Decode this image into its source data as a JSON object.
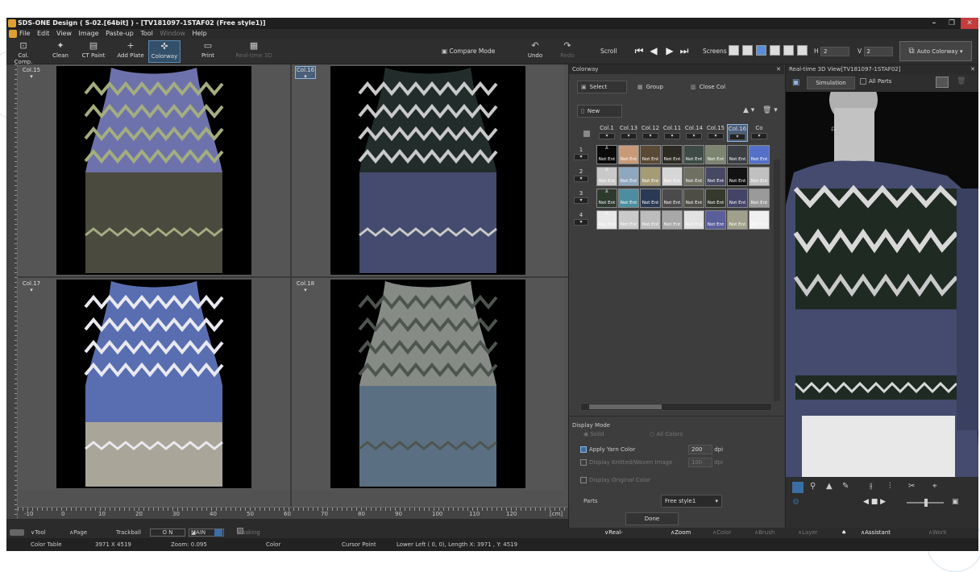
{
  "window": {
    "title": "SDS-ONE Design ( S-02.[64bit] ) - [TV181097-1STAF02 (Free style1)]",
    "controls": [
      "–",
      "❐",
      "✕"
    ]
  },
  "menu": [
    "File",
    "Edit",
    "View",
    "Image",
    "Paste-up",
    "Tool",
    "Window",
    "Help"
  ],
  "toolbar": {
    "col_comp": "Col. Comp.",
    "clean": "Clean",
    "ct_paint": "CT Paint",
    "add_plate": "Add Plate",
    "colorway": "Colorway",
    "print": "Print",
    "realtime_3d": "Real-time 3D",
    "compare_mode": "Compare Mode",
    "undo": "Undo",
    "redo": "Redo",
    "scroll": "Scroll",
    "screens": "Screens",
    "h_label": "H",
    "h_value": "2",
    "v_label": "V",
    "v_value": "2",
    "auto_colorway": "Auto Colorway"
  },
  "panes": [
    {
      "label": "Col.15",
      "selected": false,
      "body": "#4a4a3e",
      "accent": "#7277b8",
      "band": "#a4ad7e",
      "hem": "#6b6a58"
    },
    {
      "label": "Col.16",
      "selected": true,
      "body": "#444b6e",
      "accent": "#1f2a23",
      "band": "#c9c9c9",
      "hem": "#444b6e"
    },
    {
      "label": "Col.17",
      "selected": false,
      "body": "#a9a699",
      "accent": "#5068b4",
      "band": "#e9e9f0",
      "hem": "#a9a699"
    },
    {
      "label": "Col.18",
      "selected": false,
      "body": "#5b6f82",
      "accent": "#8b8e86",
      "band": "#4e5550",
      "hem": "#5b6f82"
    }
  ],
  "ruler": {
    "ticks": [
      "-10",
      "0",
      "10",
      "20",
      "30",
      "40",
      "50",
      "60",
      "70",
      "80",
      "90",
      "100",
      "110",
      "120"
    ],
    "unit": "[cm]"
  },
  "colorway_panel": {
    "title": "Colorway",
    "select": "Select",
    "group": "Group",
    "close_col": "Close Col",
    "new": "New",
    "columns": [
      "Col.1",
      "Col.13",
      "Col.12",
      "Col.11",
      "Col.14",
      "Col.15",
      "Col.16",
      "Co"
    ],
    "rows": [
      {
        "num": "1",
        "colors": [
          "#0a0a0a",
          "#c89a78",
          "#5a4a35",
          "#2c2a22",
          "#3d4a45",
          "#7c8570",
          "#3c3f44",
          "#5470c8"
        ]
      },
      {
        "num": "2",
        "colors": [
          "#c9c9c9",
          "#8fa8c0",
          "#a59c76",
          "#d6d6d6",
          "#6f6f62",
          "#464862",
          "#121212",
          "#c0c0c0"
        ]
      },
      {
        "num": "3",
        "colors": [
          "#2e3a2e",
          "#4c8ea0",
          "#2a3a55",
          "#4a4a4a",
          "#4e4e46",
          "#35382c",
          "#434466",
          "#9a9a9a"
        ]
      },
      {
        "num": "4",
        "colors": [
          "#e8e8e8",
          "#cacaca",
          "#bdbdbd",
          "#a8a8a8",
          "#e2e2e2",
          "#5a5e9a",
          "#a0a08c",
          "#f0f0f0"
        ]
      }
    ],
    "not_ent": "Not Ent",
    "display_mode": "Display Mode",
    "solid": "Solid",
    "all_colors": "All Colors",
    "apply_yarn_color": "Apply Yarn Color",
    "dpi_value_1": "200",
    "dpi": "dpi",
    "display_knitted": "Display Knitted/Woven Image",
    "dpi_value_2": "100",
    "display_original": "Display Original Color",
    "parts": "Parts",
    "parts_value": "Free style1",
    "done": "Done"
  },
  "view3d": {
    "title": "Real-time 3D View[TV181097-1STAF02]",
    "simulation": "Simulation",
    "all_parts": "All Parts"
  },
  "taskbar": {
    "tool_bar": "Tool Bar",
    "page_list": "Page List",
    "trackball": "Trackball",
    "on": "O N",
    "main": "MAIN",
    "masking": "Masking ON",
    "realtime_3d_view": "Real-time 3D View",
    "zoom_menu": "Zoom Menu",
    "color_menu": "Color Menu",
    "brush_menu": "Brush Menu",
    "layer_menu": "Layer Menu",
    "assistant_menu": "Assistant Menu",
    "work_menu": "Work Menu"
  },
  "statusbar": {
    "color_table": "Color Table",
    "size": "3971 X 4519",
    "zoom": "Zoom: 0.095",
    "color": "Color",
    "cursor_point": "Cursor Point",
    "lower_left": "Lower Left (   0,    0),  Length  X: 3971 ,  Y: 4519"
  },
  "colors": {
    "app_bg": "#3a3a3a",
    "accent": "#5b8ed8",
    "panel": "#3d3d3d"
  }
}
